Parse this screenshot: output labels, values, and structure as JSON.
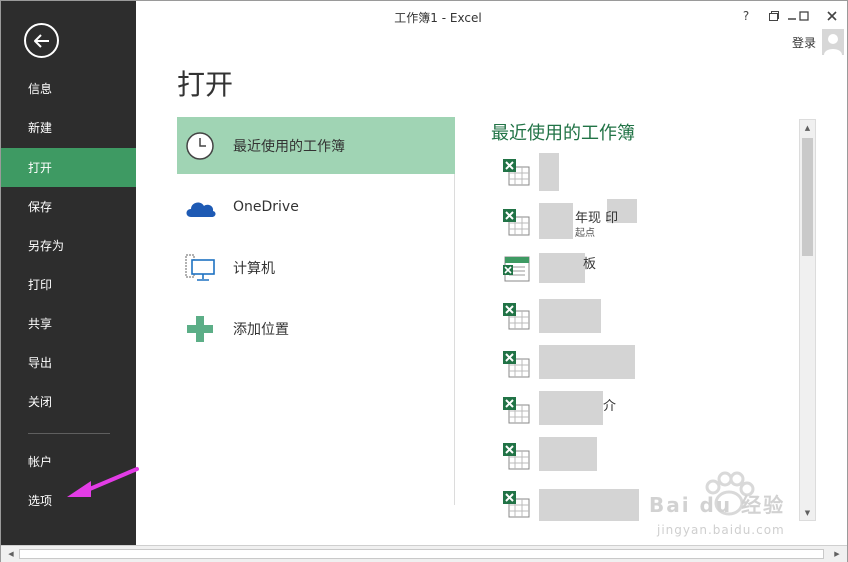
{
  "window": {
    "title": "工作簿1 - Excel",
    "help_label": "?",
    "login_label": "登录"
  },
  "sidebar": {
    "items": [
      {
        "label": "信息"
      },
      {
        "label": "新建"
      },
      {
        "label": "打开",
        "active": true
      },
      {
        "label": "保存"
      },
      {
        "label": "另存为"
      },
      {
        "label": "打印"
      },
      {
        "label": "共享"
      },
      {
        "label": "导出"
      },
      {
        "label": "关闭"
      }
    ],
    "bottom_items": [
      {
        "label": "帐户"
      },
      {
        "label": "选项"
      }
    ]
  },
  "page": {
    "title": "打开",
    "places": [
      {
        "label": "最近使用的工作簿",
        "icon": "clock-icon",
        "active": true
      },
      {
        "label": "OneDrive",
        "icon": "cloud-icon"
      },
      {
        "label": "计算机",
        "icon": "computer-icon"
      },
      {
        "label": "添加位置",
        "icon": "plus-icon"
      }
    ],
    "recent_title": "最近使用的工作簿",
    "recent_items": [
      {
        "name": "",
        "sub": ""
      },
      {
        "name": "年现  印",
        "sub": "起点"
      },
      {
        "name": "板",
        "sub": ""
      },
      {
        "name": "",
        "sub": ""
      },
      {
        "name": "",
        "sub": ""
      },
      {
        "name": "介",
        "sub": ""
      },
      {
        "name": "",
        "sub": ""
      },
      {
        "name": "",
        "sub": ""
      }
    ]
  },
  "colors": {
    "sidebar_bg": "#2d2d2d",
    "active_green": "#3e9a63",
    "place_active": "#a0d4b4",
    "excel_green": "#217346",
    "annotation_arrow": "#e33ce6"
  },
  "watermark": {
    "brand": "Bai du 经验",
    "url": "jingyan.baidu.com"
  }
}
